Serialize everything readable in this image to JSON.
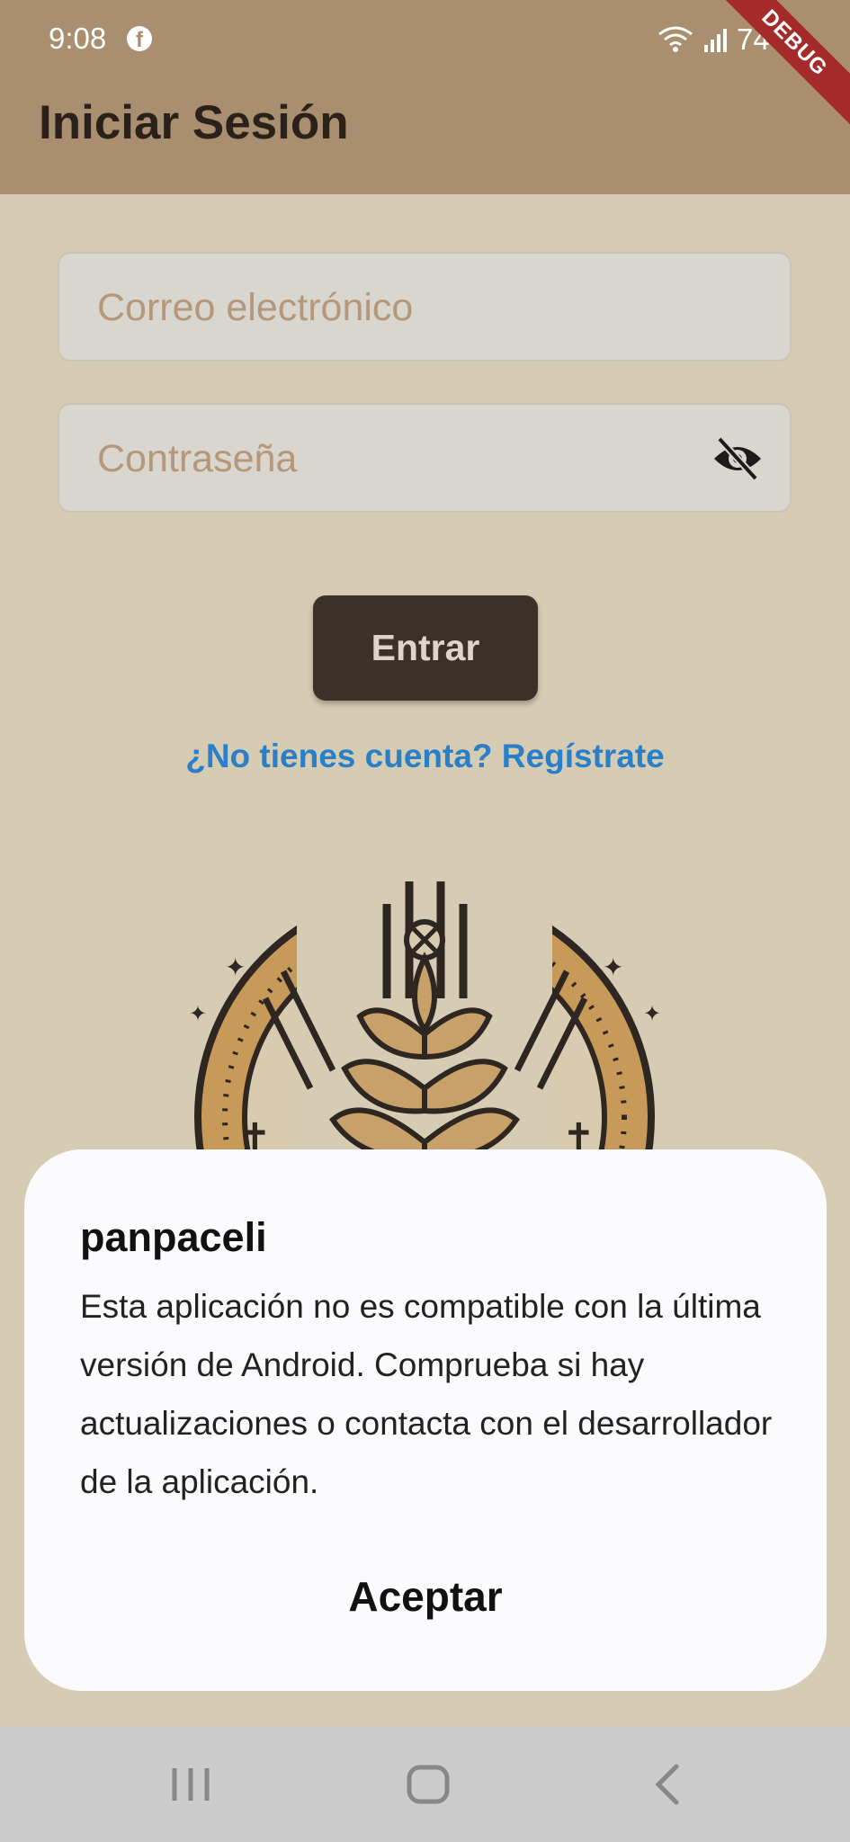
{
  "status_bar": {
    "time": "9:08",
    "battery": "74%",
    "notification_icon": "facebook-icon"
  },
  "debug_banner": "DEBUG",
  "header": {
    "title": "Iniciar Sesión"
  },
  "form": {
    "email_placeholder": "Correo electrónico",
    "email_value": "",
    "password_placeholder": "Contraseña",
    "password_value": "",
    "visibility_icon": "eye-slash-icon",
    "submit_label": "Entrar",
    "register_link": "¿No tienes cuenta? Regístrate"
  },
  "logo": {
    "icon": "wheat-emblem-logo"
  },
  "dialog": {
    "title": "panpaceli",
    "message": "Esta aplicación no es compatible con la última versión de Android. Comprueba si hay actualizaciones o contacta con el desarrollador de la aplicación.",
    "button": "Aceptar"
  },
  "nav_bar": {
    "icons": [
      "recent-apps-icon",
      "home-icon",
      "back-icon"
    ]
  },
  "colors": {
    "app_bar": "#a98f6f",
    "background": "#d6ccb3",
    "button": "#3c3128",
    "link": "#2a7fc9",
    "debug": "#a52a2a"
  }
}
